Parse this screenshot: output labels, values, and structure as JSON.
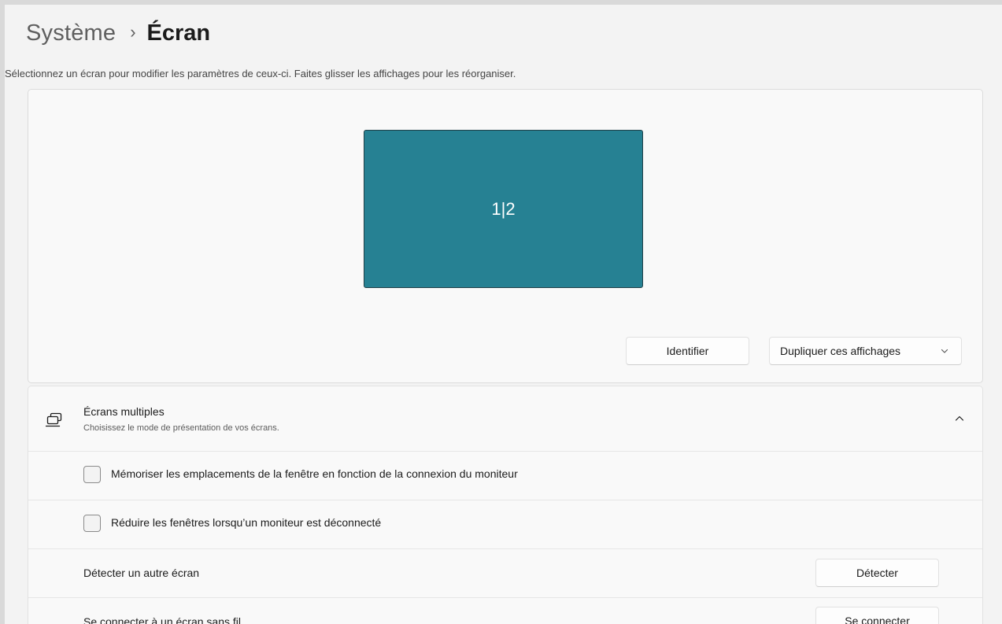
{
  "breadcrumb": {
    "parent": "Système",
    "separator": "›",
    "current": "Écran"
  },
  "description": "Sélectionnez un écran pour modifier les paramètres de ceux-ci. Faites glisser les affichages pour les réorganiser.",
  "arrangement": {
    "monitor_label": "1|2",
    "monitor_color": "#268193",
    "identify_label": "Identifier",
    "mode_dropdown_value": "Dupliquer ces affichages"
  },
  "multiple_displays": {
    "icon": "multiple-monitors-icon",
    "title": "Écrans multiples",
    "subtitle": "Choisissez le mode de présentation de vos écrans.",
    "expanded": true,
    "remember_window_locations": {
      "label": "Mémoriser les emplacements de la fenêtre en fonction de la connexion du moniteur",
      "checked": false
    },
    "minimize_windows": {
      "label": "Réduire les fenêtres lorsqu’un moniteur est déconnecté",
      "checked": false
    },
    "detect": {
      "label": "Détecter un autre écran",
      "button": "Détecter"
    },
    "wireless": {
      "label": "Se connecter à un écran sans fil",
      "button": "Se connecter"
    }
  }
}
